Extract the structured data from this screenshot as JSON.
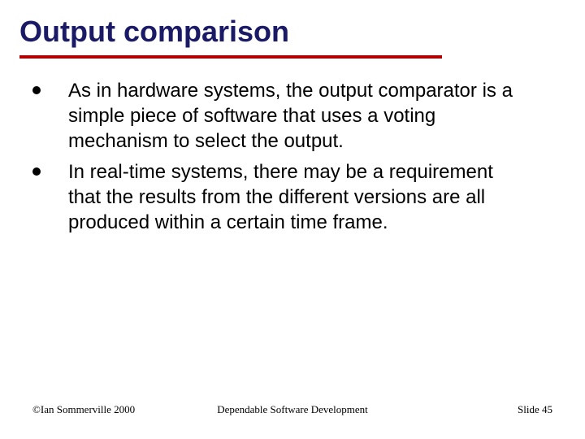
{
  "title": "Output comparison",
  "bullets": [
    "As in hardware systems, the output comparator is a simple piece of software that uses a voting mechanism to select the output.",
    "In real-time systems, there may be a requirement that the results from the different versions are all produced within a certain time frame."
  ],
  "footer": {
    "left": "©Ian Sommerville 2000",
    "center": "Dependable Software Development",
    "right": "Slide 45"
  },
  "colors": {
    "title": "#1a1a66",
    "rule": "#b00000"
  }
}
